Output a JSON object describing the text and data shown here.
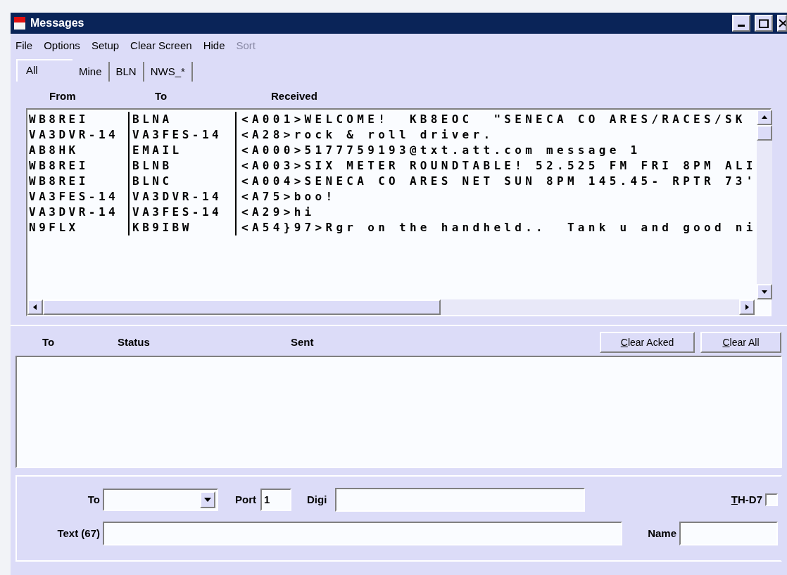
{
  "window": {
    "title": "Messages"
  },
  "menu": [
    {
      "label": "File",
      "disabled": false
    },
    {
      "label": "Options",
      "disabled": false
    },
    {
      "label": "Setup",
      "disabled": false
    },
    {
      "label": "Clear Screen",
      "disabled": false
    },
    {
      "label": "Hide",
      "disabled": false
    },
    {
      "label": "Sort",
      "disabled": true
    }
  ],
  "tabs": [
    {
      "label": "All",
      "selected": true
    },
    {
      "label": "Mine",
      "selected": false
    },
    {
      "label": "BLN",
      "selected": false
    },
    {
      "label": "NWS_*",
      "selected": false
    }
  ],
  "received": {
    "columns": [
      "From",
      "To",
      "Received"
    ],
    "rows": [
      {
        "from": "WB8REI",
        "to": "BLNA",
        "received": "<A001>WELCOME!  KB8EOC  \"SENECA CO ARES/RACES/SK"
      },
      {
        "from": "VA3DVR-14",
        "to": "VA3FES-14",
        "received": "<A28>rock & roll driver."
      },
      {
        "from": "AB8HK",
        "to": "EMAIL",
        "received": "<A000>5177759193@txt.att.com message 1"
      },
      {
        "from": "WB8REI",
        "to": "BLNB",
        "received": "<A003>SIX METER ROUNDTABLE! 52.525 FM FRI 8PM ALI"
      },
      {
        "from": "WB8REI",
        "to": "BLNC",
        "received": "<A004>SENECA CO ARES NET SUN 8PM 145.45- RPTR 73'"
      },
      {
        "from": "VA3FES-14",
        "to": "VA3DVR-14",
        "received": "<A75>boo!"
      },
      {
        "from": "VA3DVR-14",
        "to": "VA3FES-14",
        "received": "<A29>hi"
      },
      {
        "from": "N9FLX",
        "to": "KB9IBW",
        "received": "<A54}97>Rgr on the handheld..  Tank u and good ni"
      }
    ]
  },
  "sent": {
    "columns": [
      "To",
      "Status",
      "Sent"
    ],
    "buttons": [
      "Clear Acked",
      "Clear All"
    ]
  },
  "compose": {
    "to": {
      "label": "To"
    },
    "port": {
      "label": "Port",
      "value": "1"
    },
    "digi": {
      "label": "Digi"
    },
    "th_d7": {
      "label": "TH-D7",
      "checked": false
    },
    "text": {
      "label": "Text (67)"
    },
    "name": {
      "label": "Name"
    }
  }
}
